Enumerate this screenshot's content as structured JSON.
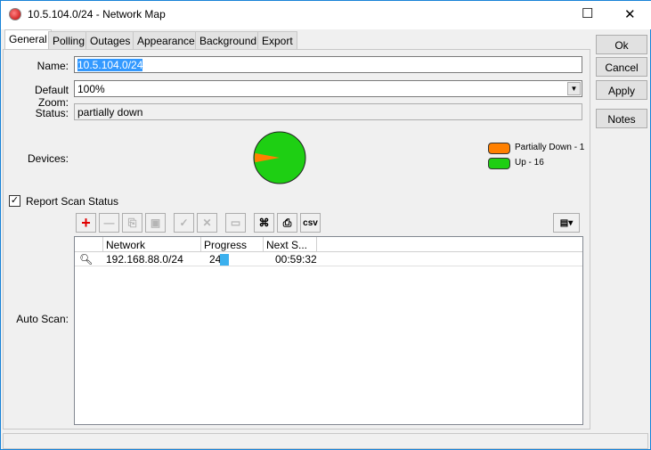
{
  "window": {
    "title": "10.5.104.0/24 - Network Map",
    "maximize": "☐",
    "close": "✕"
  },
  "tabs": [
    "General",
    "Polling",
    "Outages",
    "Appearance",
    "Background",
    "Export"
  ],
  "form": {
    "name_label": "Name:",
    "name_value": "10.5.104.0/24",
    "zoom_label": "Default Zoom:",
    "zoom_value": "100%",
    "status_label": "Status:",
    "status_value": "partially down",
    "devices_label": "Devices:",
    "report_label": "Report Scan Status",
    "autoscan_label": "Auto Scan:"
  },
  "buttons": {
    "ok": "Ok",
    "cancel": "Cancel",
    "apply": "Apply",
    "notes": "Notes"
  },
  "toolbar": {
    "csv": "csv"
  },
  "legend": [
    {
      "label": "Partially Down - 1",
      "color": "#ff8000",
      "value": 1
    },
    {
      "label": "Up - 16",
      "color": "#1ecf13",
      "value": 16
    }
  ],
  "table": {
    "headers": [
      "Network",
      "Progress",
      "Next S..."
    ],
    "rows": [
      {
        "network": "192.168.88.0/24",
        "progress": "24",
        "next": "00:59:32",
        "progress_fraction": 0.24
      }
    ]
  }
}
